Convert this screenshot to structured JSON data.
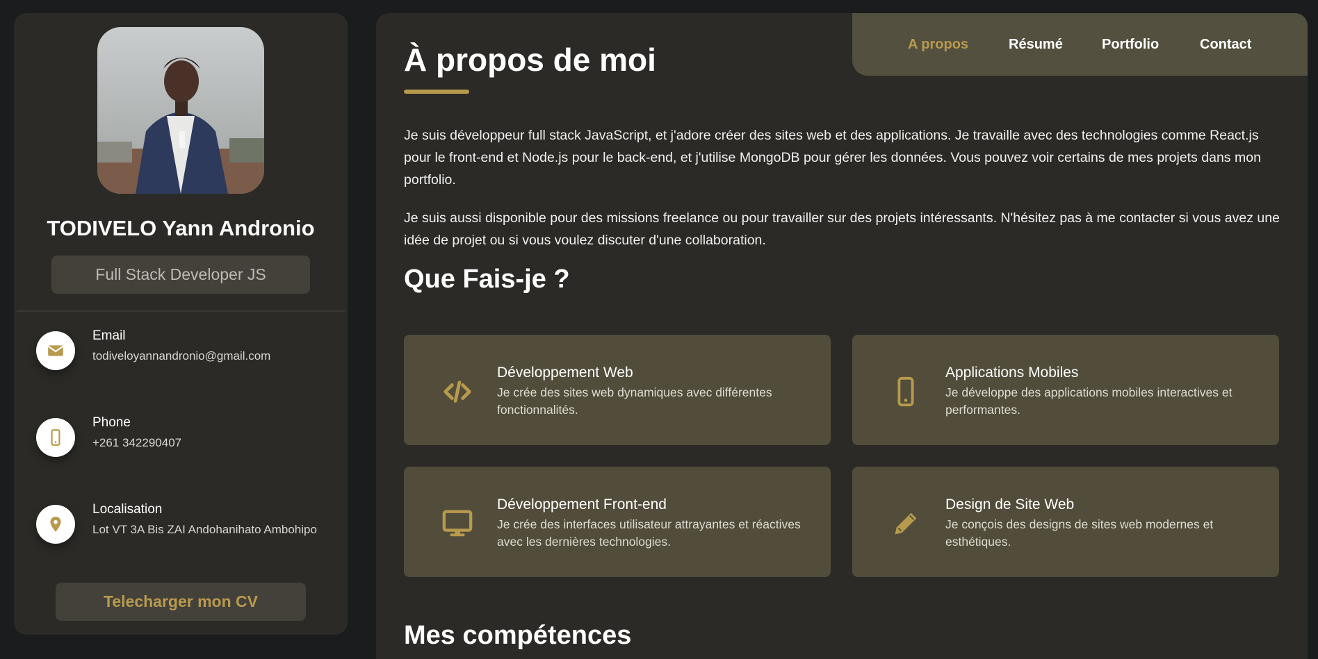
{
  "colors": {
    "accent": "#b89a4d",
    "sidebar_bg": "#2b2a26",
    "card_bg": "#524d3b",
    "page_bg": "#1b1c1e"
  },
  "profile": {
    "name": "TODIVELO Yann Andronio",
    "role": "Full Stack Developer JS",
    "avatar_icon": "profile-photo"
  },
  "contacts": [
    {
      "title": "Email",
      "value": "todiveloyannandronio@gmail.com",
      "icon": "envelope-icon"
    },
    {
      "title": "Phone",
      "value": "+261 342290407",
      "icon": "phone-icon"
    },
    {
      "title": "Localisation",
      "value": "Lot VT 3A Bis ZAI Andohanihato Ambohipo",
      "icon": "map-pin-icon"
    }
  ],
  "cv_button": "Telecharger mon CV",
  "nav": [
    {
      "label": "A propos",
      "active": true
    },
    {
      "label": "Résumé",
      "active": false
    },
    {
      "label": "Portfolio",
      "active": false
    },
    {
      "label": "Contact",
      "active": false
    }
  ],
  "about": {
    "title": "À propos de moi",
    "paragraphs": [
      "Je suis développeur full stack JavaScript, et j'adore créer des sites web et des applications. Je travaille avec des technologies comme React.js pour le front-end et Node.js pour le back-end, et j'utilise MongoDB pour gérer les données. Vous pouvez voir certains de mes projets dans mon portfolio.",
      "Je suis aussi disponible pour des missions freelance ou pour travailler sur des projets intéressants. N'hésitez pas à me contacter si vous avez une idée de projet ou si vous voulez discuter d'une collaboration."
    ]
  },
  "services": {
    "title": "Que Fais-je ?",
    "items": [
      {
        "title": "Développement Web",
        "desc": "Je crée des sites web dynamiques avec différentes fonctionnalités.",
        "icon": "code-icon"
      },
      {
        "title": "Applications Mobiles",
        "desc": "Je développe des applications mobiles interactives et performantes.",
        "icon": "mobile-icon"
      },
      {
        "title": "Développement Front-end",
        "desc": "Je crée des interfaces utilisateur attrayantes et réactives avec les dernières technologies.",
        "icon": "monitor-icon"
      },
      {
        "title": "Design de Site Web",
        "desc": "Je conçois des designs de sites web modernes et esthétiques.",
        "icon": "pencil-icon"
      }
    ]
  },
  "skills": {
    "title": "Mes compétences"
  }
}
